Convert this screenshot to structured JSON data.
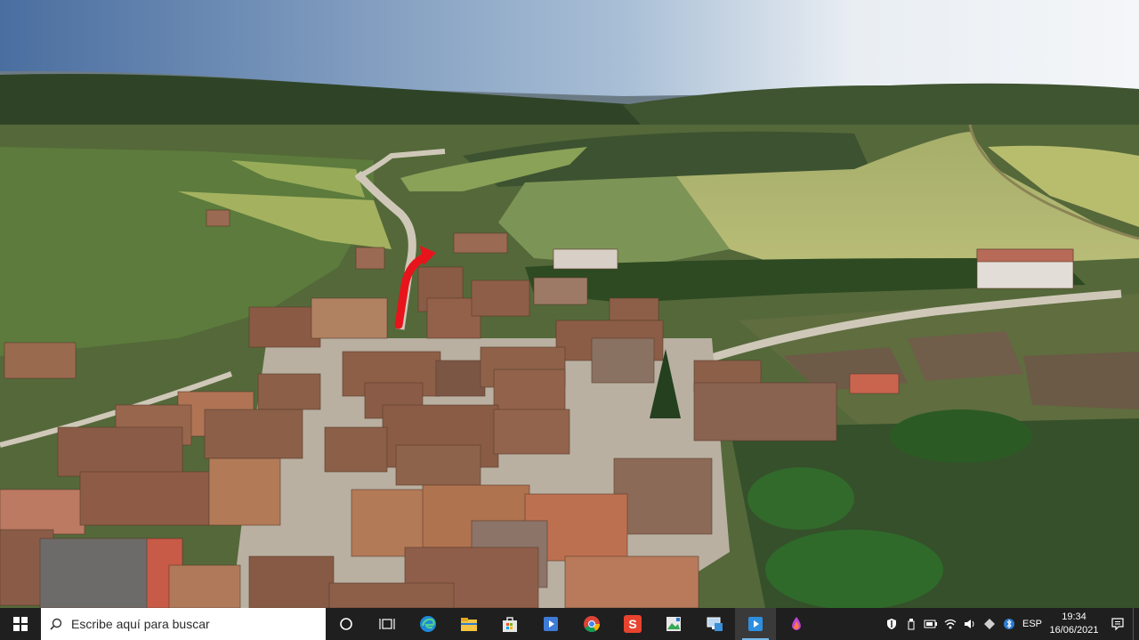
{
  "scene": {
    "alt": ""
  },
  "taskbar": {
    "search_placeholder": "Escribe aquí para buscar",
    "apps": [
      "cortana-icon",
      "task-view-icon",
      "edge-icon",
      "file-explorer-icon",
      "store-icon",
      "media-player-icon",
      "chrome-icon",
      "wps-icon",
      "photos-icon",
      "remote-desktop-icon",
      "active-app-icon",
      "paint-icon"
    ],
    "tray": {
      "language": "ESP",
      "time": "19:34",
      "date": "16/06/2021"
    }
  }
}
